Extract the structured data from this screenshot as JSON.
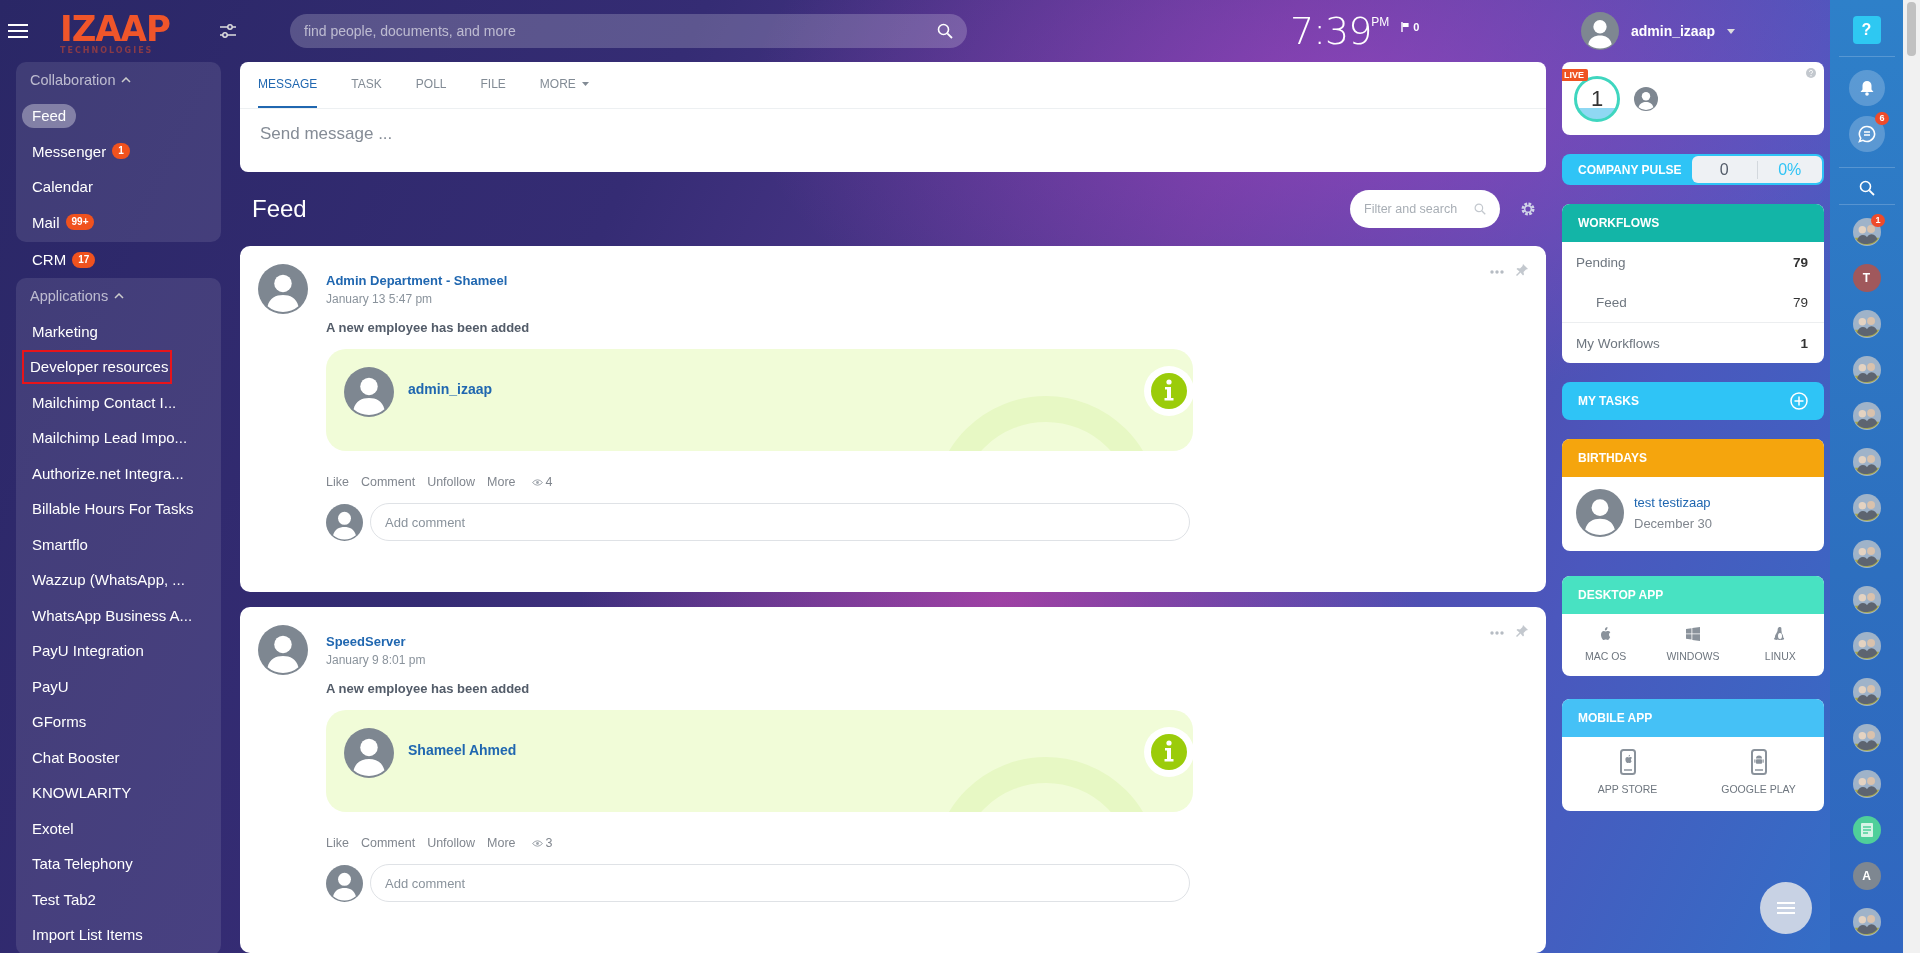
{
  "logo": {
    "name": "IZAAP",
    "tagline": "TECHNOLOGIES"
  },
  "search": {
    "placeholder": "find people, documents, and more"
  },
  "clock": {
    "time": "7:39",
    "ampm": "PM",
    "flag_count": "0"
  },
  "user": {
    "name": "admin_izaap"
  },
  "sidebar": [
    {
      "kind": "group",
      "title": "Collaboration",
      "expanded": true,
      "items": [
        {
          "label": "Feed",
          "selected": true,
          "outlined": false
        },
        {
          "label": "Messenger",
          "badge": "1",
          "selected": false,
          "outlined": false
        },
        {
          "label": "Calendar",
          "selected": false,
          "outlined": false
        },
        {
          "label": "Mail",
          "badge": "99+",
          "selected": false,
          "outlined": false
        }
      ]
    },
    {
      "kind": "item",
      "label": "CRM",
      "badge": "17",
      "selected": false,
      "outlined": false
    },
    {
      "kind": "group",
      "title": "Applications",
      "expanded": true,
      "items": [
        {
          "label": "Marketing",
          "selected": false,
          "outlined": false
        },
        {
          "label": "Developer resources",
          "selected": false,
          "outlined": true
        },
        {
          "label": "Mailchimp Contact I...",
          "selected": false,
          "outlined": false
        },
        {
          "label": "Mailchimp Lead Impo...",
          "selected": false,
          "outlined": false
        },
        {
          "label": "Authorize.net Integra...",
          "selected": false,
          "outlined": false
        },
        {
          "label": "Billable Hours For Tasks",
          "selected": false,
          "outlined": false
        },
        {
          "label": "Smartflo",
          "selected": false,
          "outlined": false
        },
        {
          "label": "Wazzup (WhatsApp, ...",
          "selected": false,
          "outlined": false
        },
        {
          "label": "WhatsApp Business A...",
          "selected": false,
          "outlined": false
        },
        {
          "label": "PayU Integration",
          "selected": false,
          "outlined": false
        },
        {
          "label": "PayU",
          "selected": false,
          "outlined": false
        },
        {
          "label": "GForms",
          "selected": false,
          "outlined": false
        },
        {
          "label": "Chat Booster",
          "selected": false,
          "outlined": false
        },
        {
          "label": "KNOWLARITY",
          "selected": false,
          "outlined": false
        },
        {
          "label": "Exotel",
          "selected": false,
          "outlined": false
        },
        {
          "label": "Tata Telephony",
          "selected": false,
          "outlined": false
        },
        {
          "label": "Test Tab2",
          "selected": false,
          "outlined": false
        },
        {
          "label": "Import List Items",
          "selected": false,
          "outlined": false
        }
      ]
    }
  ],
  "composer": {
    "tabs": [
      {
        "label": "MESSAGE",
        "kind": "tab",
        "selected": true
      },
      {
        "label": "TASK",
        "kind": "tab",
        "selected": false
      },
      {
        "label": "POLL",
        "kind": "tab",
        "selected": false
      },
      {
        "label": "FILE",
        "kind": "tab",
        "selected": false
      },
      {
        "label": "MORE",
        "kind": "menu",
        "selected": false
      }
    ],
    "placeholder": "Send message ..."
  },
  "feed": {
    "title": "Feed",
    "filter_placeholder": "Filter and search",
    "posts": [
      {
        "author": "Admin Department - Shameel",
        "date": "January 13 5:47 pm",
        "text": "A new employee has been added",
        "employee": "admin_izaap",
        "actions": [
          "Like",
          "Comment",
          "Unfollow",
          "More"
        ],
        "views": "4",
        "comment_placeholder": "Add comment"
      },
      {
        "author": "SpeedServer",
        "date": "January 9 8:01 pm",
        "text": "A new employee has been added",
        "employee": "Shameel Ahmed",
        "actions": [
          "Like",
          "Comment",
          "Unfollow",
          "More"
        ],
        "views": "3",
        "comment_placeholder": "Add comment"
      }
    ]
  },
  "widgets": {
    "live": {
      "badge": "LIVE",
      "count": "1"
    },
    "pulse": {
      "title": "COMPANY PULSE",
      "value": "0",
      "percent": "0%"
    },
    "workflows": {
      "title": "WORKFLOWS",
      "rows": [
        {
          "label": "Pending",
          "value": "79",
          "kind": "total"
        },
        {
          "label": "Feed",
          "value": "79",
          "kind": "sub"
        },
        {
          "label": "My Workflows",
          "value": "1",
          "kind": "total"
        }
      ]
    },
    "tasks": {
      "title": "MY TASKS"
    },
    "birthdays": {
      "title": "BIRTHDAYS",
      "people": [
        {
          "name": "test testizaap",
          "date": "December 30"
        }
      ]
    },
    "desktop_app": {
      "title": "DESKTOP APP",
      "platforms": [
        {
          "label": "MAC OS",
          "kind": "apple"
        },
        {
          "label": "WINDOWS",
          "kind": "windows"
        },
        {
          "label": "LINUX",
          "kind": "linux"
        }
      ]
    },
    "mobile_app": {
      "title": "MOBILE APP",
      "platforms": [
        {
          "label": "APP STORE",
          "kind": "ios"
        },
        {
          "label": "GOOGLE PLAY",
          "kind": "android"
        }
      ]
    }
  },
  "rail": {
    "help": "?",
    "items": [
      {
        "kind": "bell"
      },
      {
        "kind": "chat",
        "badge": "6"
      },
      {
        "kind": "search"
      },
      {
        "kind": "photo",
        "badge": "1"
      },
      {
        "kind": "letter",
        "letter": "T",
        "color": "#a0585c"
      },
      {
        "kind": "photo"
      },
      {
        "kind": "photo"
      },
      {
        "kind": "photo"
      },
      {
        "kind": "photo"
      },
      {
        "kind": "photo"
      },
      {
        "kind": "photo"
      },
      {
        "kind": "photo"
      },
      {
        "kind": "photo"
      },
      {
        "kind": "photo"
      },
      {
        "kind": "photo"
      },
      {
        "kind": "photo"
      },
      {
        "kind": "doc"
      },
      {
        "kind": "letter",
        "letter": "A",
        "color": "#7e8791"
      },
      {
        "kind": "photo"
      }
    ]
  }
}
